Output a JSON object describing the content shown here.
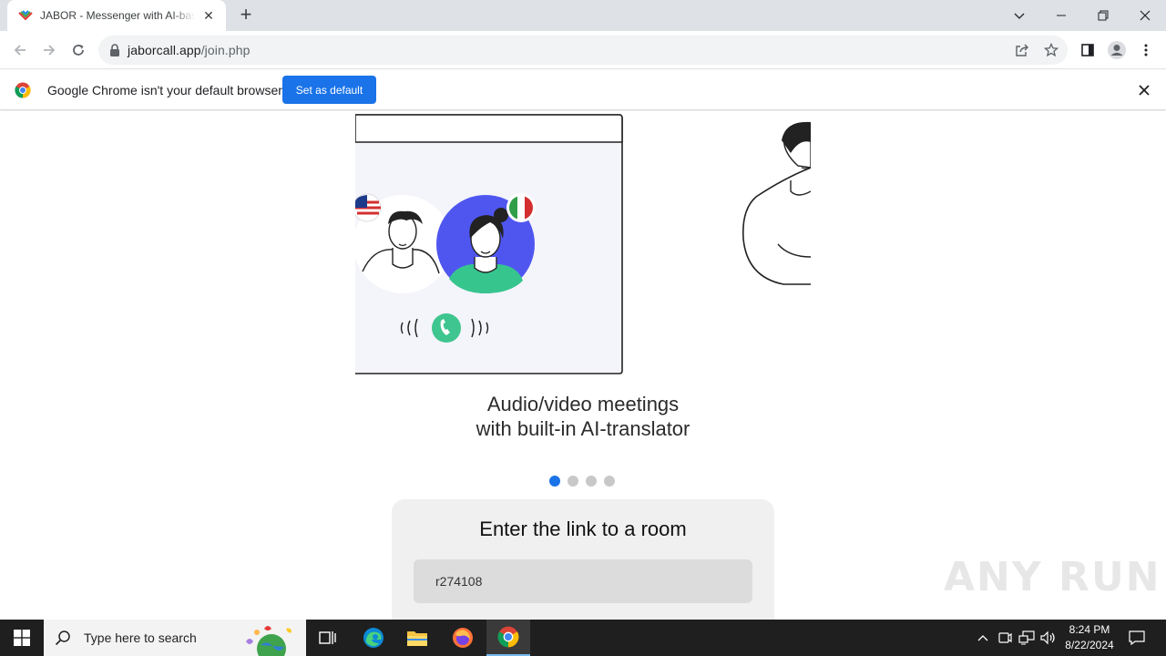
{
  "browser": {
    "tab_title": "JABOR - Messenger with AI-based translator",
    "url_host": "jaborcall.app",
    "url_path": "/join.php",
    "infobar_text": "Google Chrome isn't your default browser",
    "set_default_label": "Set as default"
  },
  "page": {
    "caption_line1": "Audio/video meetings",
    "caption_line2": "with built-in AI-translator",
    "slides_total": 4,
    "slide_active": 1,
    "room_title": "Enter the link to a room",
    "room_input_value": "r274108"
  },
  "taskbar": {
    "search_placeholder": "Type here to search",
    "time": "8:24 PM",
    "date": "8/22/2024"
  },
  "watermark": "ANY RUN",
  "colors": {
    "accent": "#1a73e8",
    "avatar_purple": "#4f56f0",
    "avatar_green": "#37c58e",
    "call_green": "#3fc58f"
  }
}
